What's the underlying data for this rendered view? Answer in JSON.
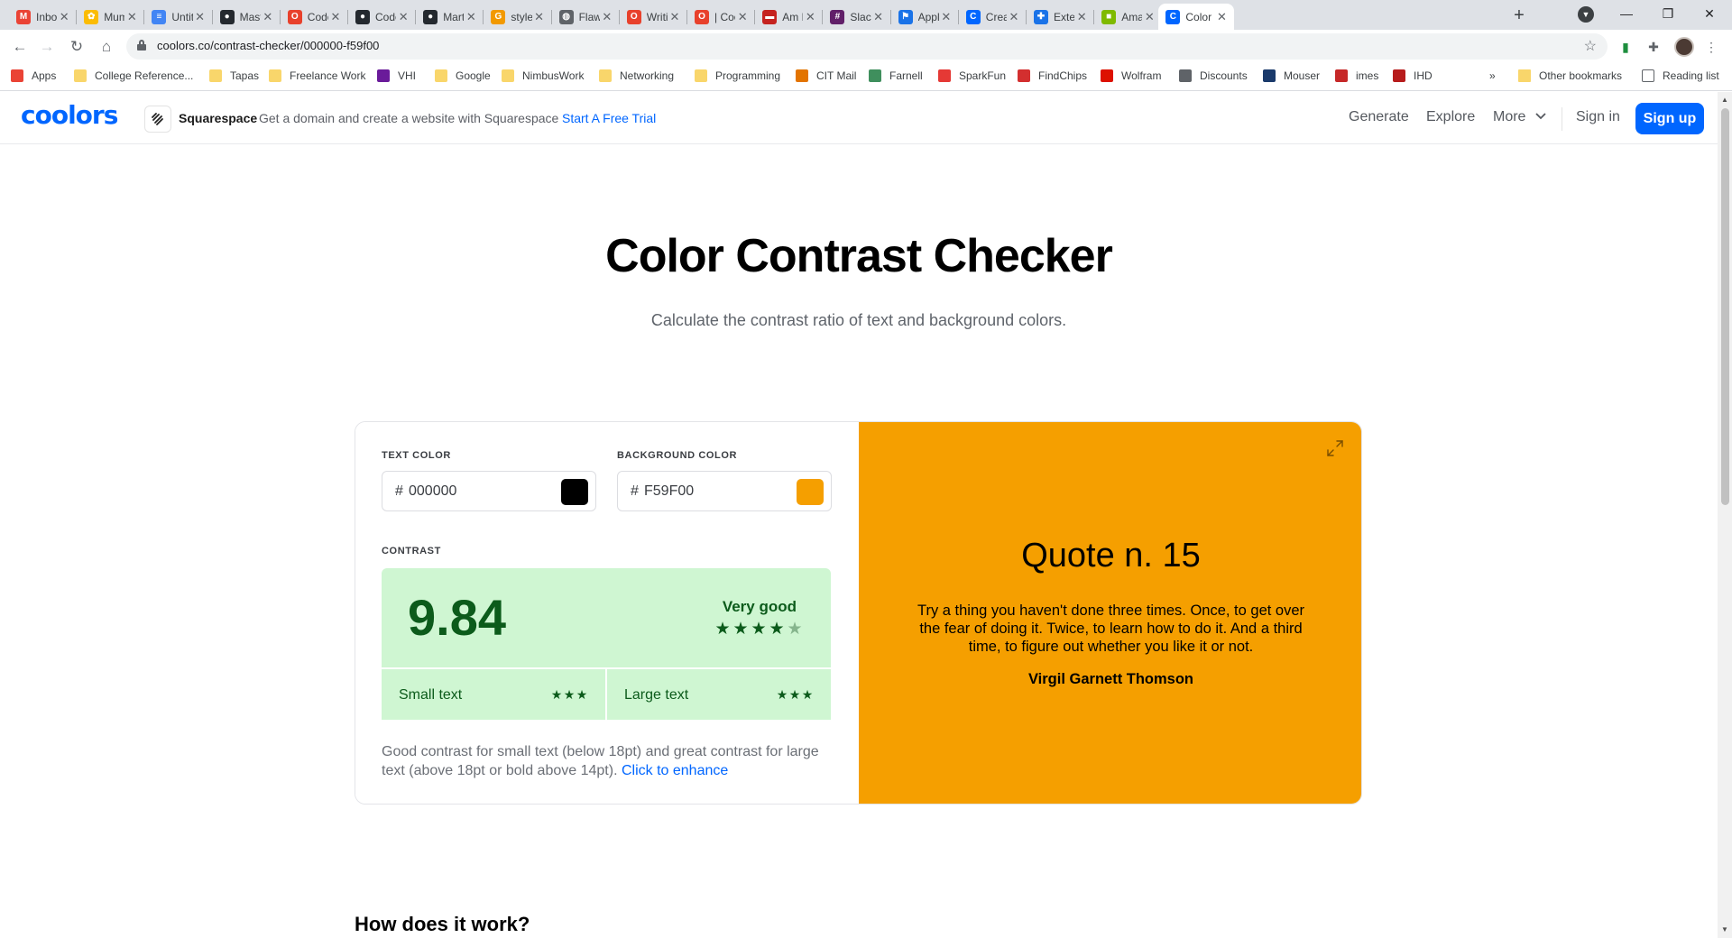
{
  "browser": {
    "tabs": [
      {
        "title": "Inbox",
        "favicon": "gmail-icon",
        "color": "#ea4335",
        "glyph": "M"
      },
      {
        "title": "Mum",
        "favicon": "google-photos-icon",
        "color": "#fbbc04",
        "glyph": "✿"
      },
      {
        "title": "Untitl",
        "favicon": "google-docs-icon",
        "color": "#4285f4",
        "glyph": "≡"
      },
      {
        "title": "Maste",
        "favicon": "github-icon",
        "color": "#24292f",
        "glyph": "●"
      },
      {
        "title": "Code",
        "favicon": "opera-icon",
        "color": "#e8412c",
        "glyph": "O"
      },
      {
        "title": "Code",
        "favicon": "github-icon",
        "color": "#24292f",
        "glyph": "●"
      },
      {
        "title": "Marti",
        "favicon": "github-icon",
        "color": "#24292f",
        "glyph": "●"
      },
      {
        "title": "style",
        "favicon": "google-search-icon",
        "color": "#f29900",
        "glyph": "G"
      },
      {
        "title": "Flawl",
        "favicon": "globe-icon",
        "color": "#5f6368",
        "glyph": "◍"
      },
      {
        "title": "Writi",
        "favicon": "opera-icon",
        "color": "#e8412c",
        "glyph": "O"
      },
      {
        "title": "| Coo",
        "favicon": "opera-icon",
        "color": "#e8412c",
        "glyph": "O"
      },
      {
        "title": "Am I",
        "favicon": "red-square-icon",
        "color": "#c5221f",
        "glyph": "▬"
      },
      {
        "title": "Slack",
        "favicon": "slack-icon",
        "color": "#611f69",
        "glyph": "#"
      },
      {
        "title": "Appli",
        "favicon": "flag-icon",
        "color": "#1a73e8",
        "glyph": "⚑"
      },
      {
        "title": "Creat",
        "favicon": "coolors-icon",
        "color": "#0066ff",
        "glyph": "C"
      },
      {
        "title": "Exter",
        "favicon": "puzzle-icon",
        "color": "#1a73e8",
        "glyph": "✚"
      },
      {
        "title": "Amaz",
        "favicon": "microsoft-icon",
        "color": "#7fba00",
        "glyph": "■"
      },
      {
        "title": "Color",
        "favicon": "coolors-icon",
        "color": "#0066ff",
        "glyph": "C",
        "active": true
      }
    ],
    "url": "coolors.co/contrast-checker/000000-f59f00",
    "bookmarks": [
      {
        "label": "Apps",
        "icon": "apps-grid-icon",
        "color": "#ea4335"
      },
      {
        "label": "College Reference...",
        "icon": "folder-icon",
        "color": "#f9d66b"
      },
      {
        "label": "Tapas",
        "icon": "folder-icon",
        "color": "#f9d66b"
      },
      {
        "label": "Freelance Work",
        "icon": "folder-icon",
        "color": "#f9d66b"
      },
      {
        "label": "VHI",
        "icon": "vhi-icon",
        "color": "#6a1b9a"
      },
      {
        "label": "Google",
        "icon": "folder-icon",
        "color": "#f9d66b"
      },
      {
        "label": "NimbusWork",
        "icon": "folder-icon",
        "color": "#f9d66b"
      },
      {
        "label": "Networking",
        "icon": "folder-icon",
        "color": "#f9d66b"
      },
      {
        "label": "Programming",
        "icon": "folder-icon",
        "color": "#f9d66b"
      },
      {
        "label": "CIT Mail",
        "icon": "cit-mail-icon",
        "color": "#e37400"
      },
      {
        "label": "Farnell",
        "icon": "farnell-icon",
        "color": "#3f8f5d"
      },
      {
        "label": "SparkFun",
        "icon": "sparkfun-icon",
        "color": "#e53935"
      },
      {
        "label": "FindChips",
        "icon": "findchips-icon",
        "color": "#d32f2f"
      },
      {
        "label": "Wolfram",
        "icon": "wolfram-icon",
        "color": "#dd1100"
      },
      {
        "label": "Discounts",
        "icon": "discounts-icon",
        "color": "#5f6368"
      },
      {
        "label": "Mouser",
        "icon": "mouser-icon",
        "color": "#1a3a6b"
      },
      {
        "label": "imes",
        "icon": "eet-icon",
        "color": "#c62828"
      },
      {
        "label": "IHD",
        "icon": "ihd-icon",
        "color": "#b71c1c"
      }
    ],
    "other_bookmarks": "Other bookmarks",
    "reading_list": "Reading list",
    "overflow": "»"
  },
  "site": {
    "logo": "coolors",
    "ad": {
      "brand": "Squarespace",
      "text": "Get a domain and create a website with Squarespace",
      "cta": "Start A Free Trial"
    },
    "nav": {
      "generate": "Generate",
      "explore": "Explore",
      "more": "More",
      "signin": "Sign in",
      "signup": "Sign up"
    }
  },
  "page": {
    "title": "Color Contrast Checker",
    "subtitle": "Calculate the contrast ratio of text and background colors."
  },
  "checker": {
    "text_color_label": "TEXT COLOR",
    "text_color_value": "000000",
    "text_color_hex": "#000000",
    "bg_color_label": "BACKGROUND COLOR",
    "bg_color_value": "F59F00",
    "bg_color_hex": "#f59f00",
    "hash": "#",
    "contrast_label": "CONTRAST",
    "ratio": "9.84",
    "rating": "Very good",
    "rating_stars": 4,
    "rating_stars_max": 5,
    "small_text_label": "Small text",
    "small_text_stars": 3,
    "large_text_label": "Large text",
    "large_text_stars": 3,
    "description": "Good contrast for small text (below 18pt) and great contrast for large text (above 18pt or bold above 14pt).",
    "enhance_link": "Click to enhance"
  },
  "preview": {
    "quote_title": "Quote n. 15",
    "quote_text": "Try a thing you haven't done three times. Once, to get over the fear of doing it. Twice, to learn how to do it. And a third time, to figure out whether you like it or not.",
    "quote_author": "Virgil Garnett Thomson"
  },
  "section": {
    "how_title": "How does it work?"
  },
  "colors": {
    "brand_blue": "#0066ff",
    "preview_bg": "#f59f00",
    "score_green_bg": "#cff6d2",
    "score_green_text": "#0c5b1b"
  }
}
